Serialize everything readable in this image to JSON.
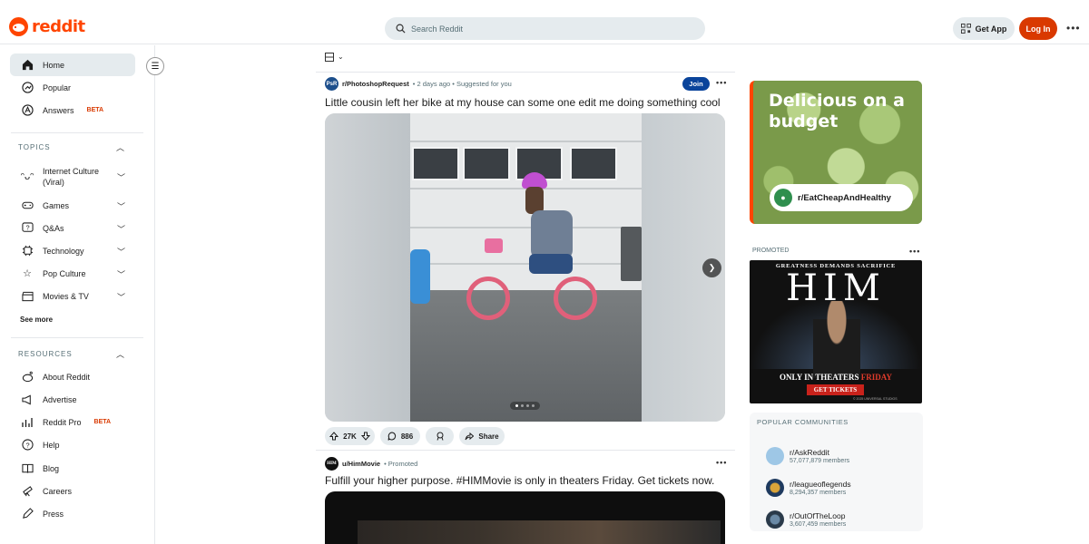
{
  "header": {
    "logo_text": "reddit",
    "search_placeholder": "Search Reddit",
    "get_app": "Get App",
    "login": "Log In"
  },
  "sidebar": {
    "main": [
      {
        "label": "Home",
        "icon": "home-icon"
      },
      {
        "label": "Popular",
        "icon": "popular-icon"
      },
      {
        "label": "Answers",
        "badge": "BETA",
        "icon": "answers-icon"
      }
    ],
    "topics_title": "TOPICS",
    "topics": [
      {
        "label": "Internet Culture",
        "label2": "(Viral)"
      },
      {
        "label": "Games"
      },
      {
        "label": "Q&As"
      },
      {
        "label": "Technology"
      },
      {
        "label": "Pop Culture"
      },
      {
        "label": "Movies & TV"
      }
    ],
    "see_more": "See more",
    "resources_title": "RESOURCES",
    "resources": [
      {
        "label": "About Reddit"
      },
      {
        "label": "Advertise"
      },
      {
        "label": "Reddit Pro",
        "badge": "BETA"
      },
      {
        "label": "Help"
      },
      {
        "label": "Blog"
      },
      {
        "label": "Careers"
      },
      {
        "label": "Press"
      }
    ]
  },
  "post1": {
    "sub_icon": "PsR",
    "subreddit": "r/PhotoshopRequest",
    "meta": "• 2 days ago • Suggested for you",
    "join": "Join",
    "title": "Little cousin left her bike at my house can some one edit me doing something cool",
    "upvotes": "27K",
    "comments": "886",
    "share": "Share"
  },
  "post2": {
    "sub_icon": "HIM",
    "user": "u/HimMovie",
    "meta": "• Promoted",
    "title": "Fulfill your higher purpose. #HIMMovie is only in theaters Friday. Get tickets now."
  },
  "right": {
    "ad1_title": "Delicious on a budget",
    "ad1_sub": "r/EatCheapAndHealthy",
    "promoted": "PROMOTED",
    "ad2_top": "GREATNESS DEMANDS SACRIFICE",
    "ad2_title": "HIM",
    "ad2_only": "ONLY IN THEATERS",
    "ad2_day": "FRIDAY",
    "ad2_btn": "GET TICKETS",
    "ad2_copy": "© 2025 UNIVERSAL STUDIOS",
    "popular_title": "POPULAR COMMUNITIES",
    "communities": [
      {
        "name": "r/AskReddit",
        "members": "57,077,879 members",
        "color": "#9ec7e6"
      },
      {
        "name": "r/leagueoflegends",
        "members": "8,294,357 members",
        "color": "#1e3a5f"
      },
      {
        "name": "r/OutOfTheLoop",
        "members": "3,607,459 members",
        "color": "#2a3a4a"
      }
    ]
  },
  "colors": {
    "brand": "#ff4500",
    "login": "#d93900",
    "join": "#0a449b"
  }
}
